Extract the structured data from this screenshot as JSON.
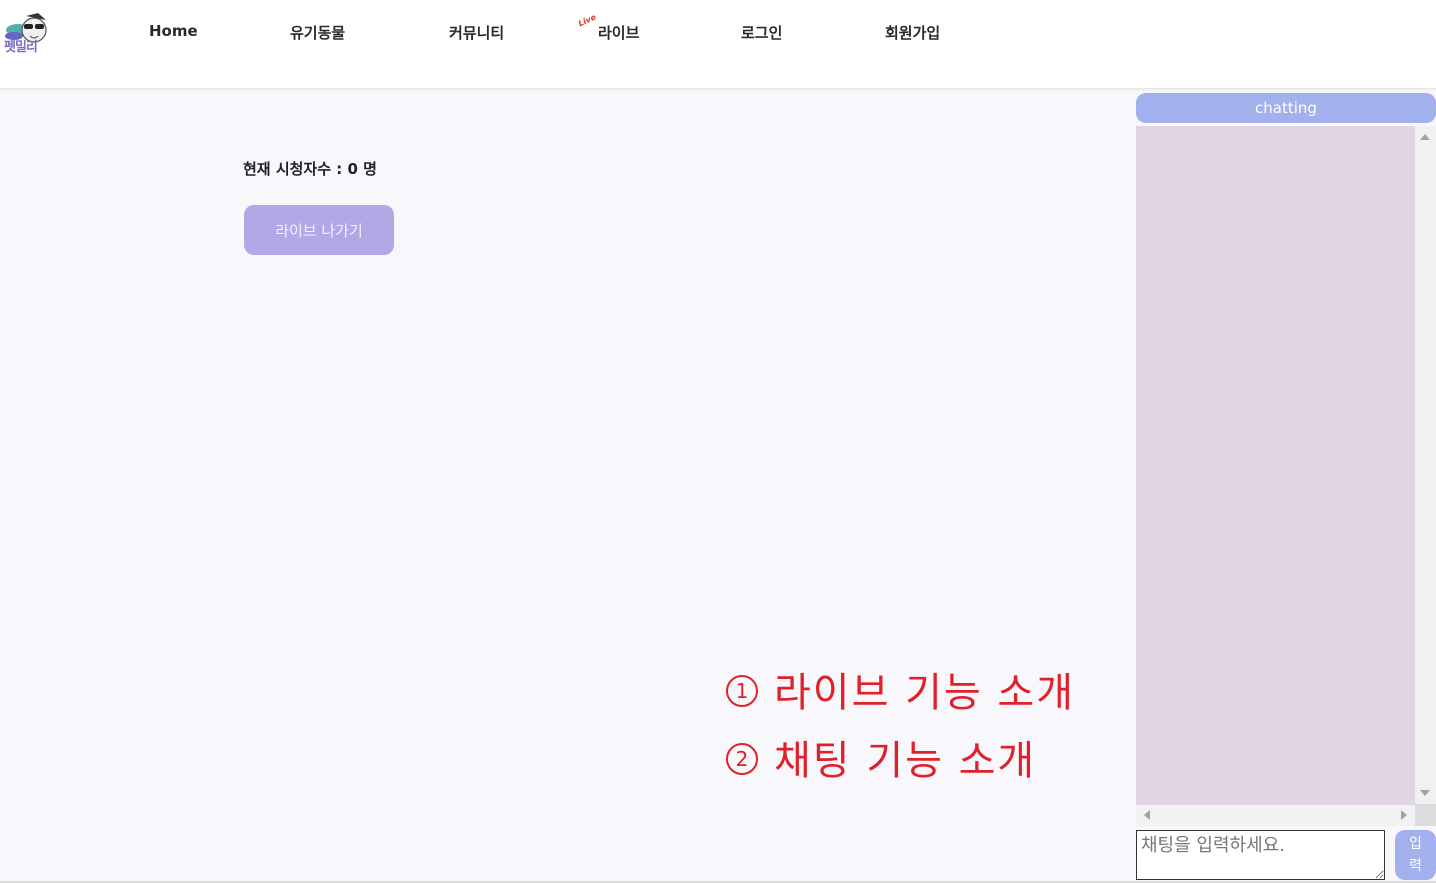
{
  "header": {
    "logo_text": "펫밀리",
    "live_badge": "Live",
    "nav": [
      {
        "label": "Home"
      },
      {
        "label": "유기동물"
      },
      {
        "label": "커뮤니티"
      },
      {
        "label": "라이브"
      },
      {
        "label": "로그인"
      },
      {
        "label": "회원가입"
      }
    ]
  },
  "main": {
    "viewer_count": "현재 시청자수 : 0 명",
    "leave_button": "라이브 나가기"
  },
  "annotations": [
    {
      "num": "1",
      "text": "라이브 기능 소개"
    },
    {
      "num": "2",
      "text": "채팅 기능 소개"
    }
  ],
  "chat": {
    "title": "chatting",
    "input_placeholder": "채팅을 입력하세요.",
    "send_label": "입력"
  },
  "colors": {
    "accent_purple": "#b1a9e6",
    "accent_blue": "#a3b0ee",
    "chat_bg": "#e0d6e3",
    "annotation_red": "#e0202a"
  }
}
